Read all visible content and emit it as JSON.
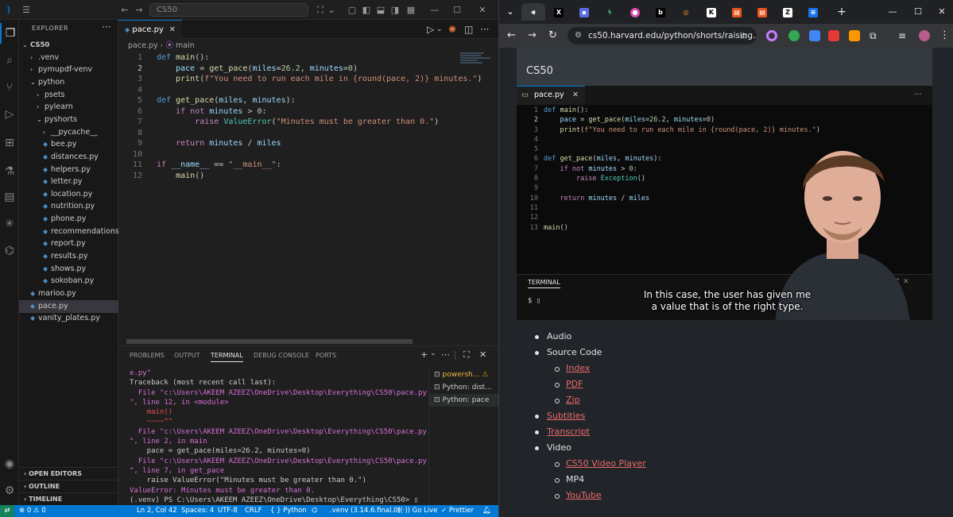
{
  "vscode": {
    "search_text": "CS50",
    "explorer_title": "EXPLORER",
    "tree": [
      {
        "label": "CS50",
        "kind": "root",
        "depth": 0
      },
      {
        "label": ".venv",
        "kind": "folder-closed",
        "depth": 1
      },
      {
        "label": "pymupdf-venv",
        "kind": "folder-closed",
        "depth": 1
      },
      {
        "label": "python",
        "kind": "folder-open",
        "depth": 1
      },
      {
        "label": "psets",
        "kind": "folder-closed",
        "depth": 2
      },
      {
        "label": "pylearn",
        "kind": "folder-closed",
        "depth": 2
      },
      {
        "label": "pyshorts",
        "kind": "folder-open",
        "depth": 2
      },
      {
        "label": "__pycache__",
        "kind": "folder-closed",
        "depth": 3
      },
      {
        "label": "bee.py",
        "kind": "file",
        "depth": 3
      },
      {
        "label": "distances.py",
        "kind": "file",
        "depth": 3
      },
      {
        "label": "helpers.py",
        "kind": "file",
        "depth": 3
      },
      {
        "label": "letter.py",
        "kind": "file",
        "depth": 3
      },
      {
        "label": "location.py",
        "kind": "file",
        "depth": 3
      },
      {
        "label": "nutrition.py",
        "kind": "file",
        "depth": 3
      },
      {
        "label": "phone.py",
        "kind": "file",
        "depth": 3
      },
      {
        "label": "recommendations.py",
        "kind": "file",
        "depth": 3
      },
      {
        "label": "report.py",
        "kind": "file",
        "depth": 3
      },
      {
        "label": "results.py",
        "kind": "file",
        "depth": 3
      },
      {
        "label": "shows.py",
        "kind": "file",
        "depth": 3
      },
      {
        "label": "sokoban.py",
        "kind": "file",
        "depth": 3
      },
      {
        "label": "marioo.py",
        "kind": "file",
        "depth": 1
      },
      {
        "label": "pace.py",
        "kind": "file",
        "depth": 1,
        "selected": true
      },
      {
        "label": "vanity_plates.py",
        "kind": "file",
        "depth": 1
      }
    ],
    "sections": [
      "OPEN EDITORS",
      "OUTLINE",
      "TIMELINE"
    ],
    "tab_label": "pace.py",
    "breadcrumb_file": "pace.py",
    "breadcrumb_symbol": "main",
    "code": [
      {
        "n": "1",
        "t": "def main():"
      },
      {
        "n": "2",
        "t": "    pace = get_pace(miles=26.2, minutes=0)"
      },
      {
        "n": "3",
        "t": "    print(f\"You need to run each mile in {round(pace, 2)} minutes.\")"
      },
      {
        "n": "4",
        "t": ""
      },
      {
        "n": "5",
        "t": "def get_pace(miles, minutes):"
      },
      {
        "n": "6",
        "t": "    if not minutes > 0:"
      },
      {
        "n": "7",
        "t": "        raise ValueError(\"Minutes must be greater than 0.\")"
      },
      {
        "n": "8",
        "t": ""
      },
      {
        "n": "9",
        "t": "    return minutes / miles"
      },
      {
        "n": "10",
        "t": ""
      },
      {
        "n": "11",
        "t": "if __name__ == \"__main__\":"
      },
      {
        "n": "12",
        "t": "    main()"
      }
    ],
    "panel_tabs": [
      "PROBLEMS",
      "OUTPUT",
      "TERMINAL",
      "DEBUG CONSOLE",
      "PORTS"
    ],
    "terminal_lines": [
      {
        "t": "e.py\"",
        "c": "path"
      },
      {
        "t": "Traceback (most recent call last):",
        "c": ""
      },
      {
        "t": "  File \"c:\\Users\\AKEEM AZEEZ\\OneDrive\\Desktop\\Everything\\CS50\\pace.py",
        "c": "path"
      },
      {
        "t": "\", line 12, in <module>",
        "c": "path"
      },
      {
        "t": "    main()",
        "c": "err"
      },
      {
        "t": "    ~~~~^^",
        "c": "err"
      },
      {
        "t": "  File \"c:\\Users\\AKEEM AZEEZ\\OneDrive\\Desktop\\Everything\\CS50\\pace.py",
        "c": "path"
      },
      {
        "t": "\", line 2, in main",
        "c": "path"
      },
      {
        "t": "    pace = get_pace(miles=26.2, minutes=0)",
        "c": ""
      },
      {
        "t": "  File \"c:\\Users\\AKEEM AZEEZ\\OneDrive\\Desktop\\Everything\\CS50\\pace.py",
        "c": "path"
      },
      {
        "t": "\", line 7, in get_pace",
        "c": "path"
      },
      {
        "t": "    raise ValueError(\"Minutes must be greater than 0.\")",
        "c": ""
      },
      {
        "t": "ValueError: Minutes must be greater than 0.",
        "c": "errname"
      },
      {
        "t": "(.venv) PS C:\\Users\\AKEEM AZEEZ\\OneDrive\\Desktop\\Everything\\CS50> ▯",
        "c": ""
      }
    ],
    "terminals": [
      {
        "label": "powersh...",
        "warn": true
      },
      {
        "label": "Python: dist...",
        "warn": false
      },
      {
        "label": "Python: pace",
        "warn": false,
        "selected": true
      }
    ],
    "status": {
      "problems": "⊗ 0 ⚠ 0",
      "position": "Ln 2, Col 42",
      "spaces": "Spaces: 4",
      "encoding": "UTF-8",
      "eol": "CRLF",
      "language": "{ } Python",
      "interpreter": ".venv (3.14.6.final.0)",
      "golive": "((·)) Go Live",
      "prettier": "✓ Prettier"
    }
  },
  "browser": {
    "url": "cs50.harvard.edu/python/shorts/raising...",
    "site_title": "CS50",
    "video_tab": "pace.py",
    "video_code": [
      {
        "n": "1",
        "t": "def main():"
      },
      {
        "n": "2",
        "t": "    pace = get_pace(miles=26.2, minutes=0)"
      },
      {
        "n": "3",
        "t": "    print(f\"You need to run each mile in {round(pace, 2)} minutes.\")"
      },
      {
        "n": "4",
        "t": ""
      },
      {
        "n": "5",
        "t": ""
      },
      {
        "n": "6",
        "t": "def get_pace(miles, minutes):"
      },
      {
        "n": "7",
        "t": "    if not minutes > 0:"
      },
      {
        "n": "8",
        "t": "        raise Exception()"
      },
      {
        "n": "9",
        "t": ""
      },
      {
        "n": "10",
        "t": "    return minutes / miles"
      },
      {
        "n": "11",
        "t": ""
      },
      {
        "n": "12",
        "t": ""
      },
      {
        "n": "13",
        "t": "main()"
      }
    ],
    "video_terminal_label": "TERMINAL",
    "video_prompt": "$ ▯",
    "caption_line1": "In this case, the user has given me",
    "caption_line2": "a value that is of the right type.",
    "links": [
      {
        "label": "Audio",
        "level": 1,
        "link": false
      },
      {
        "label": "Source Code",
        "level": 1,
        "link": false
      },
      {
        "label": "Index",
        "level": 2,
        "link": true
      },
      {
        "label": "PDF",
        "level": 2,
        "link": true
      },
      {
        "label": "Zip",
        "level": 2,
        "link": true
      },
      {
        "label": "Subtitles",
        "level": 1,
        "link": true
      },
      {
        "label": "Transcript",
        "level": 1,
        "link": true
      },
      {
        "label": "Video",
        "level": 1,
        "link": false
      },
      {
        "label": "CS50 Video Player",
        "level": 2,
        "link": true
      },
      {
        "label": "MP4",
        "level": 2,
        "link": false
      },
      {
        "label": "YouTube",
        "level": 2,
        "link": true
      }
    ]
  }
}
